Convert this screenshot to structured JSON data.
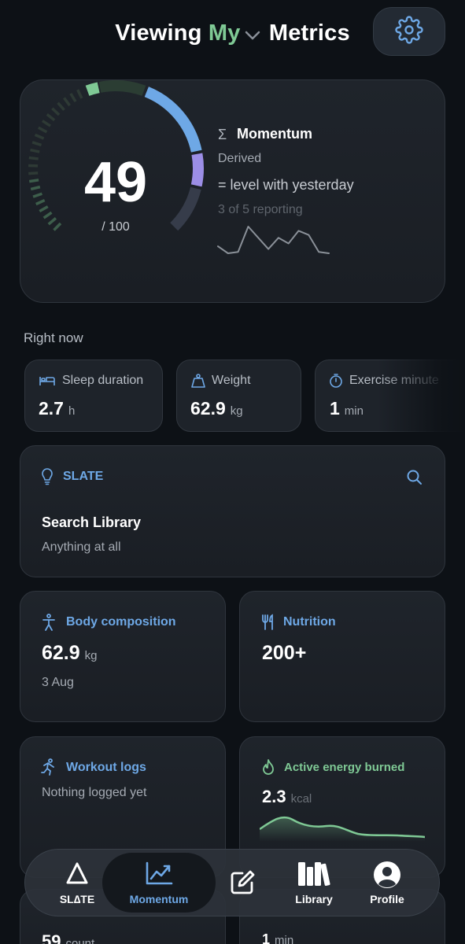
{
  "header": {
    "viewing": "Viewing",
    "who": "My",
    "metrics": "Metrics"
  },
  "momentum": {
    "score": "49",
    "max_label": "/ 100",
    "score_fraction": 0.49,
    "sigma": "Σ",
    "title": "Momentum",
    "derived": "Derived",
    "trend": "= level with yesterday",
    "reporting": "3 of 5 reporting",
    "sparkline": [
      20,
      25,
      24,
      6,
      14,
      22,
      14,
      18,
      9,
      12,
      24,
      25
    ]
  },
  "right_now": {
    "label": "Right now",
    "chips": [
      {
        "label": "Sleep duration",
        "value": "2.7",
        "unit": "h",
        "icon": "bed-icon"
      },
      {
        "label": "Weight",
        "value": "62.9",
        "unit": "kg",
        "icon": "scale-icon"
      },
      {
        "label": "Exercise minute",
        "value": "1",
        "unit": "min",
        "icon": "stopwatch-icon"
      }
    ]
  },
  "slate": {
    "title": "SLATE",
    "search_title": "Search Library",
    "search_placeholder": "Anything at all"
  },
  "tiles": {
    "body": {
      "title": "Body composition",
      "value": "62.9",
      "unit": "kg",
      "date": "3 Aug"
    },
    "nutrition": {
      "title": "Nutrition",
      "value": "200+"
    },
    "workout": {
      "title": "Workout logs",
      "empty": "Nothing logged yet"
    },
    "energy": {
      "title": "Active energy burned",
      "value": "2.3",
      "unit": "kcal"
    },
    "below_left": {
      "value": "59",
      "unit": "count"
    },
    "below_right": {
      "value": "1",
      "unit": "min"
    }
  },
  "nav": {
    "items": [
      {
        "label": "SL∆TE",
        "icon": "delta-icon"
      },
      {
        "label": "Momentum",
        "icon": "trend-chart-icon"
      },
      {
        "label": "",
        "icon": "compose-icon"
      },
      {
        "label": "Library",
        "icon": "books-icon"
      },
      {
        "label": "Profile",
        "icon": "person-icon"
      }
    ]
  },
  "colors": {
    "accent_green": "#7fc995",
    "accent_blue": "#6ea8e6",
    "accent_purple": "#9c8ee6",
    "background": "#0d1116"
  }
}
